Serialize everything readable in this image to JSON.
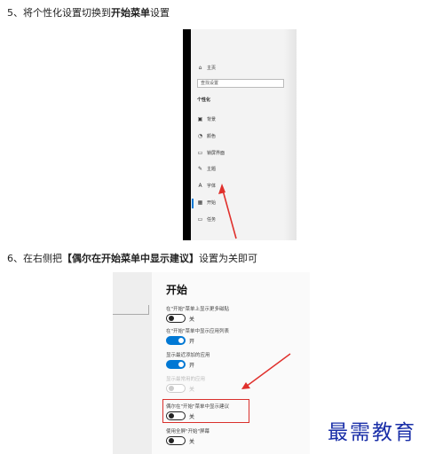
{
  "step5": {
    "prefix": "5、将个性化设置切换到",
    "bold": "开始菜单",
    "suffix": "设置"
  },
  "step6": {
    "prefix": "6、在右侧把",
    "bold": "【偶尔在开始菜单中显示建议】",
    "suffix": "设置为关即可"
  },
  "screenshot1": {
    "home_icon": "home-icon",
    "home_label": "主页",
    "search_placeholder": "查找设置",
    "section_title": "个性化",
    "items": [
      {
        "icon": "▣",
        "label": "背景"
      },
      {
        "icon": "◔",
        "label": "颜色"
      },
      {
        "icon": "▭",
        "label": "锁屏界面"
      },
      {
        "icon": "✎",
        "label": "主题"
      },
      {
        "icon": "A",
        "label": "字体"
      },
      {
        "icon": "▦",
        "label": "开始"
      },
      {
        "icon": "▭",
        "label": "任务"
      }
    ]
  },
  "screenshot2": {
    "title": "开始",
    "options": [
      {
        "label": "在\"开始\"菜单上显示更多磁贴",
        "state": "关",
        "on": false,
        "disabled": false
      },
      {
        "label": "在\"开始\"菜单中显示应用列表",
        "state": "开",
        "on": true,
        "disabled": false
      },
      {
        "label": "显示最近添加的应用",
        "state": "开",
        "on": true,
        "disabled": false
      },
      {
        "label": "显示最常用的应用",
        "state": "关",
        "on": false,
        "disabled": true
      },
      {
        "label": "偶尔在\"开始\"菜单中显示建议",
        "state": "关",
        "on": false,
        "disabled": false
      },
      {
        "label": "使用全屏\"开始\"屏幕",
        "state": "关",
        "on": false,
        "disabled": false
      }
    ]
  },
  "colors": {
    "accent": "#0078d4",
    "highlight": "#d9302c",
    "watermark": "#1a2fa8"
  },
  "watermark": "最需教育"
}
